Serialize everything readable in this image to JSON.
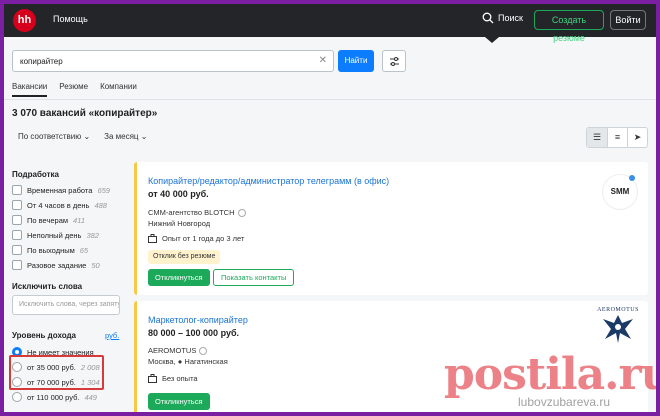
{
  "header": {
    "logo": "hh",
    "help": "Помощь",
    "search": "Поиск",
    "create_resume": "Создать резюме",
    "login": "Войти"
  },
  "search": {
    "query": "копирайтер",
    "find_button": "Найти"
  },
  "tabs": [
    {
      "label": "Вакансии",
      "active": true
    },
    {
      "label": "Резюме",
      "active": false
    },
    {
      "label": "Компании",
      "active": false
    }
  ],
  "results_title": "3 070 вакансий «копирайтер»",
  "sort": {
    "order": "По соответствию",
    "period": "За месяц"
  },
  "sidebar": {
    "part_time_title": "Подработка",
    "part_time": [
      {
        "label": "Временная работа",
        "count": "659"
      },
      {
        "label": "От 4 часов в день",
        "count": "488"
      },
      {
        "label": "По вечерам",
        "count": "411"
      },
      {
        "label": "Неполный день",
        "count": "382"
      },
      {
        "label": "По выходным",
        "count": "65"
      },
      {
        "label": "Разовое задание",
        "count": "50"
      }
    ],
    "exclude_title": "Исключить слова",
    "exclude_placeholder": "Исключить слова, через запятую",
    "income_title": "Уровень дохода",
    "income_currency": "руб.",
    "income": [
      {
        "label": "Не имеет значения",
        "count": "",
        "selected": true
      },
      {
        "label": "от 35 000 руб.",
        "count": "2 008",
        "selected": false
      },
      {
        "label": "от 70 000 руб.",
        "count": "1 304",
        "selected": false
      },
      {
        "label": "от 110 000 руб.",
        "count": "449",
        "selected": false
      }
    ]
  },
  "vacancies": [
    {
      "title": "Копирайтер/редактор/администратор телеграмм (в офис)",
      "salary": "от 40 000 руб.",
      "employer": "СММ-агентство BLOTCH",
      "city": "Нижний Новгород",
      "experience": "Опыт от 1 года до 3 лет",
      "badge": "Отклик без резюме",
      "apply": "Откликнуться",
      "contacts": "Показать контакты",
      "logo_text": "SMM"
    },
    {
      "title": "Маркетолог-копирайтер",
      "salary": "80 000 – 100 000 руб.",
      "employer": "AEROMOTUS",
      "city": "Москва",
      "metro": "Нагатинская",
      "experience": "Без опыта",
      "apply": "Откликнуться",
      "logo_text": "AEROMOTUS"
    }
  ],
  "watermark": {
    "main": "postila.ru",
    "sub": "lubovzubareva.ru"
  },
  "colors": {
    "header_bg": "#232529",
    "primary_blue": "#0d7dff",
    "green": "#1da95a",
    "link_blue": "#1a73d6",
    "highlight_red": "#d73a3a"
  }
}
